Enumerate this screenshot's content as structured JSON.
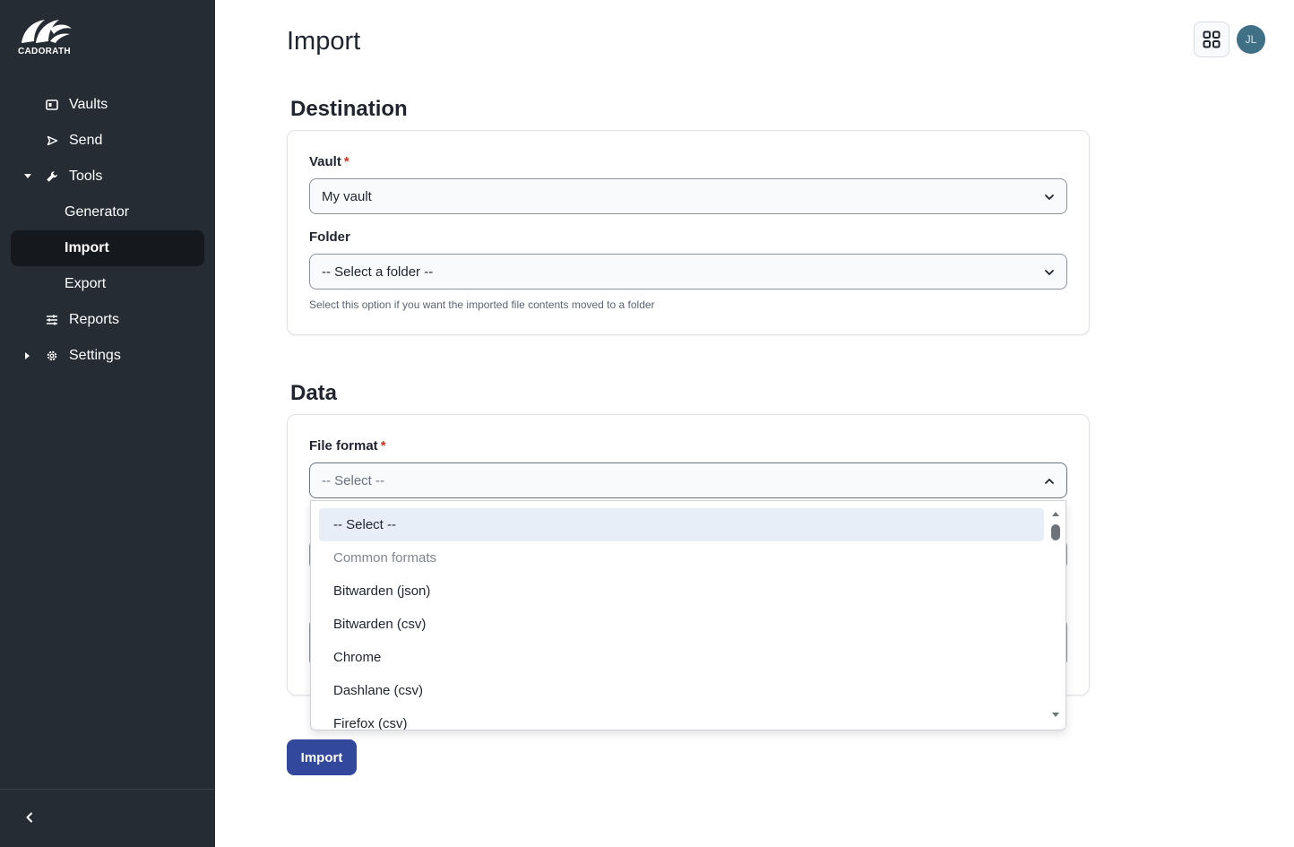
{
  "brand": {
    "name": "CADORATH"
  },
  "sidebar": {
    "items": [
      {
        "label": "Vaults",
        "icon": "vault-icon"
      },
      {
        "label": "Send",
        "icon": "send-icon"
      },
      {
        "label": "Tools",
        "icon": "wrench-icon",
        "expanded": true
      },
      {
        "label": "Generator"
      },
      {
        "label": "Import",
        "active": true
      },
      {
        "label": "Export"
      },
      {
        "label": "Reports",
        "icon": "sliders-icon"
      },
      {
        "label": "Settings",
        "icon": "gear-icon",
        "expanded": false
      }
    ],
    "collapse_icon": "chevron-left-icon"
  },
  "header": {
    "title": "Import",
    "avatar_initials": "JL",
    "apps_icon": "grid-icon"
  },
  "destination": {
    "title": "Destination",
    "vault_label": "Vault",
    "vault_value": "My vault",
    "folder_label": "Folder",
    "folder_value": "-- Select a folder --",
    "folder_hint": "Select this option if you want the imported file contents moved to a folder"
  },
  "data_section": {
    "title": "Data",
    "file_format_label": "File format",
    "file_format_value": "-- Select --",
    "options": [
      {
        "label": "-- Select --",
        "selected": true
      },
      {
        "label": "Common formats",
        "group": true
      },
      {
        "label": "Bitwarden (json)"
      },
      {
        "label": "Bitwarden (csv)"
      },
      {
        "label": "Chrome"
      },
      {
        "label": "Dashlane (csv)"
      },
      {
        "label": "Firefox (csv)"
      }
    ]
  },
  "actions": {
    "import_label": "Import"
  },
  "colors": {
    "sidebar_bg": "#262c33",
    "active_bg": "#15181c",
    "primary": "#31489d",
    "required": "#c83522",
    "avatar": "#3f7086"
  }
}
